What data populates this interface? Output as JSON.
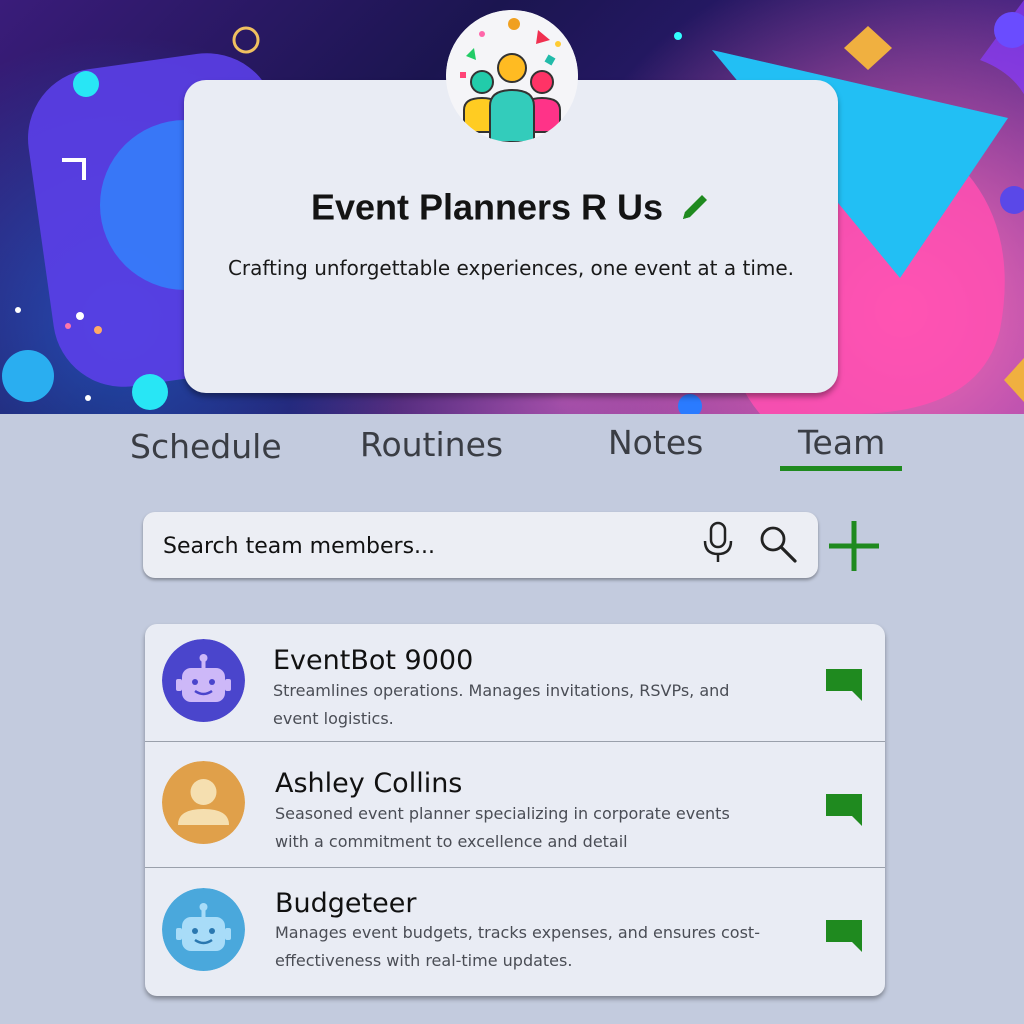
{
  "header": {
    "org_name": "Event Planners R Us",
    "tagline": "Crafting unforgettable experiences, one event at a time."
  },
  "tabs": [
    {
      "label": "Schedule",
      "active": false
    },
    {
      "label": "Routines",
      "active": false
    },
    {
      "label": "Notes",
      "active": false
    },
    {
      "label": "Team",
      "active": true
    }
  ],
  "search": {
    "placeholder": "Search team members...",
    "value": ""
  },
  "team": [
    {
      "name": "EventBot 9000",
      "description": "Streamlines operations. Manages invitations, RSVPs, and event logistics.",
      "avatar": "robot-icon",
      "avatar_color": "#4a45cc"
    },
    {
      "name": "Ashley Collins",
      "description": "Seasoned event planner specializing in corporate events with a commitment to excellence and detail",
      "avatar": "person-icon",
      "avatar_color": "#e0a04a"
    },
    {
      "name": "Budgeteer",
      "description": "Manages event budgets, tracks expenses, and ensures cost-effectiveness with real-time updates.",
      "avatar": "robot-icon",
      "avatar_color": "#4aa8dc"
    }
  ],
  "colors": {
    "accent": "#1f8a1f",
    "page_bg": "#c3cbde",
    "card_bg": "#e9ecf4"
  },
  "icons": {
    "edit": "pencil-icon",
    "mic": "microphone-icon",
    "search": "search-icon",
    "add": "plus-icon",
    "chat": "chat-bubble-icon"
  }
}
